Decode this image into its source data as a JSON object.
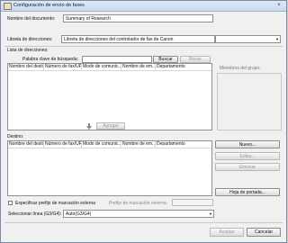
{
  "window": {
    "title": "Configuración de envío de faxes",
    "close_icon": "×"
  },
  "document_name": {
    "label": "Nombre del documento:",
    "value": "Summary of Research"
  },
  "address_book": {
    "label": "Libreta de direcciones:",
    "selected": "Libreta de direcciones del controlador de fax de Canon",
    "arrow": "▼"
  },
  "address_list": {
    "title": "Lista de direcciones:",
    "search_label": "Palabra clave de búsqueda:",
    "search_value": "",
    "search_button": "Buscar",
    "clear_button": "Borrar",
    "columns": [
      "Nombre del destino",
      "Número de fax/URI",
      "Modo de comunic...",
      "Nombre de em...",
      "Departamento"
    ],
    "group_members_label": "Miembros del grupo:"
  },
  "add_button": "Agregar",
  "destination": {
    "title": "Destino:",
    "columns": [
      "Nombre del destino",
      "Número de fax/URI",
      "Modo de comunic...",
      "Nombre de em...",
      "Departamento"
    ],
    "new_button": "Nuevo...",
    "edit_button": "Editar...",
    "delete_button": "Eliminar",
    "cover_sheet_button": "Hoja de portada..."
  },
  "external_prefix": {
    "checkbox_label": "Especificar prefijo de marcación externa",
    "prefix_label": "Prefijo de marcación externa:",
    "prefix_value": ""
  },
  "line_select": {
    "label": "Seleccionar línea (G3/G4):",
    "selected": "Auto(G3/G4)",
    "arrow": "▼"
  },
  "footer": {
    "accept_button": "Aceptar",
    "cancel_button": "Cancelar"
  }
}
